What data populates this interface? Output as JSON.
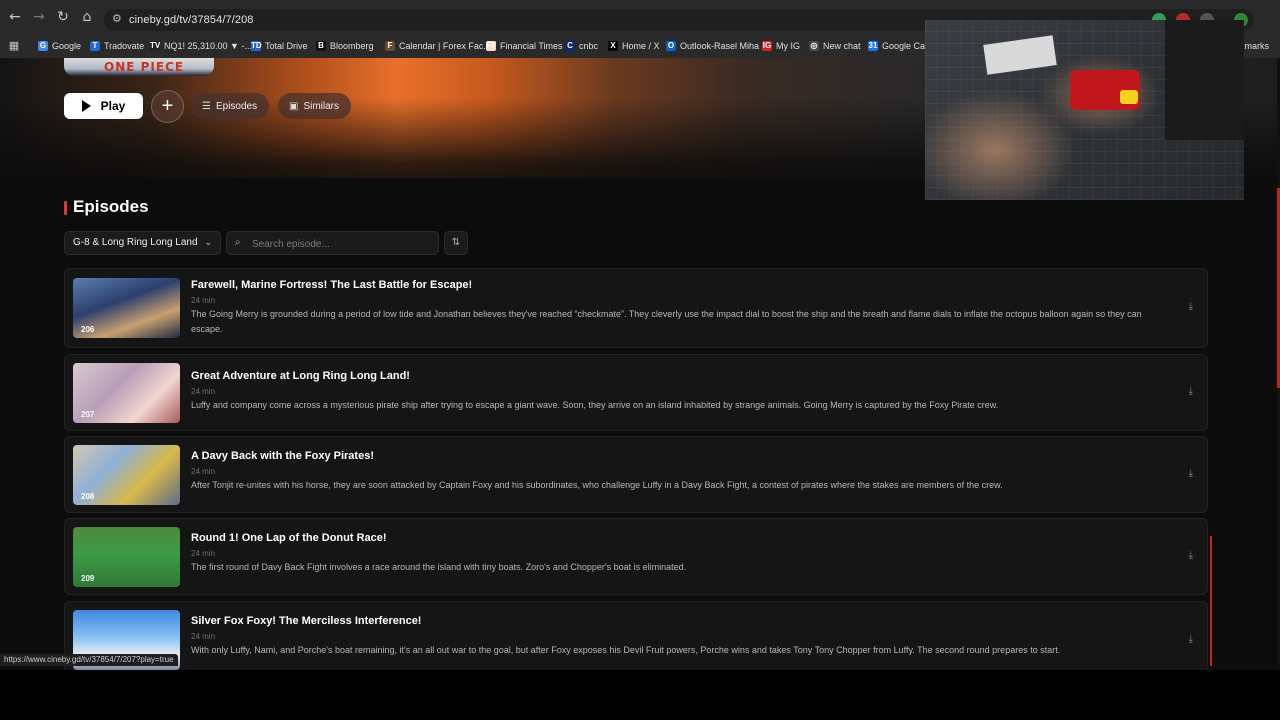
{
  "browser": {
    "url": "cineby.gd/tv/37854/7/208",
    "status_url": "https://www.cineby.gd/tv/37854/7/207?play=true",
    "bookmarks": [
      {
        "label": "Google",
        "icon": "google-icon",
        "color": "#4285f4",
        "glyph": "G"
      },
      {
        "label": "Tradovate",
        "icon": "tradovate-icon",
        "color": "#1e6ad6",
        "glyph": "T"
      },
      {
        "label": "NQ1! 25,310.00 ▼ -...",
        "icon": "tradingview-icon",
        "color": "#222222",
        "glyph": "TV"
      },
      {
        "label": "Total Drive",
        "icon": "totaldrive-icon",
        "color": "#2a62c9",
        "glyph": "TD"
      },
      {
        "label": "Bloomberg",
        "icon": "bloomberg-icon",
        "color": "#111111",
        "glyph": "B"
      },
      {
        "label": "Calendar | Forex Fac...",
        "icon": "forexfactory-icon",
        "color": "#6b4b2e",
        "glyph": "F"
      },
      {
        "label": "Financial Times",
        "icon": "ft-icon",
        "color": "#f2dfce",
        "glyph": "FT"
      },
      {
        "label": "cnbc",
        "icon": "cnbc-icon",
        "color": "#0a2a6a",
        "glyph": "C"
      },
      {
        "label": "Home / X",
        "icon": "x-icon",
        "color": "#000000",
        "glyph": "X"
      },
      {
        "label": "Outlook-Rasel Miha",
        "icon": "outlook-icon",
        "color": "#0b63c6",
        "glyph": "O"
      },
      {
        "label": "My IG",
        "icon": "ig-icon",
        "color": "#d2232a",
        "glyph": "IG"
      },
      {
        "label": "New chat",
        "icon": "chat-icon",
        "color": "#444444",
        "glyph": "◎"
      },
      {
        "label": "Google Cale",
        "icon": "calendar-icon",
        "color": "#1a73e8",
        "glyph": "31"
      }
    ],
    "bookmarks_overflow": "kmarks"
  },
  "hero": {
    "logo_text": "ONE PIECE",
    "play_label": "Play",
    "add_label": "+",
    "episodes_label": "Episodes",
    "similars_label": "Similars"
  },
  "episodes_section": {
    "title": "Episodes",
    "season": "G-8 & Long Ring Long Land",
    "search_placeholder": "Search episode...",
    "accent": "#e2343a",
    "items": [
      {
        "number": "206",
        "title": "Farewell, Marine Fortress! The Last Battle for Escape!",
        "duration": "24 min",
        "description": "The Going Merry is grounded during a period of low tide and Jonathan believes they've reached “checkmate”. They cleverly use the impact dial to boost the ship and the breath and flame dials to inflate the octopus balloon again so they can escape."
      },
      {
        "number": "207",
        "title": "Great Adventure at Long Ring Long Land!",
        "duration": "24 min",
        "description": "Luffy and company come across a mysterious pirate ship after trying to escape a giant wave. Soon, they arrive on an island inhabited by strange animals. Going Merry is captured by the Foxy Pirate crew."
      },
      {
        "number": "208",
        "title": "A Davy Back with the Foxy Pirates!",
        "duration": "24 min",
        "description": "After Tonjit re-unites with his horse, they are soon attacked by Captain Foxy and his subordinates, who challenge Luffy in a Davy Back Fight, a contest of pirates where the stakes are members of the crew."
      },
      {
        "number": "209",
        "title": "Round 1! One Lap of the Donut Race!",
        "duration": "24 min",
        "description": "The first round of Davy Back Fight involves a race around the island with tiny boats. Zoro's and Chopper's boat is eliminated."
      },
      {
        "number": "210",
        "title": "Silver Fox Foxy! The Merciless Interference!",
        "duration": "24 min",
        "description": "With only Luffy, Nami, and Porche's boat remaining, it's an all out war to the goal, but after Foxy exposes his Devil Fruit powers, Porche wins and takes Tony Tony Chopper from Luffy. The second round prepares to start."
      }
    ]
  }
}
